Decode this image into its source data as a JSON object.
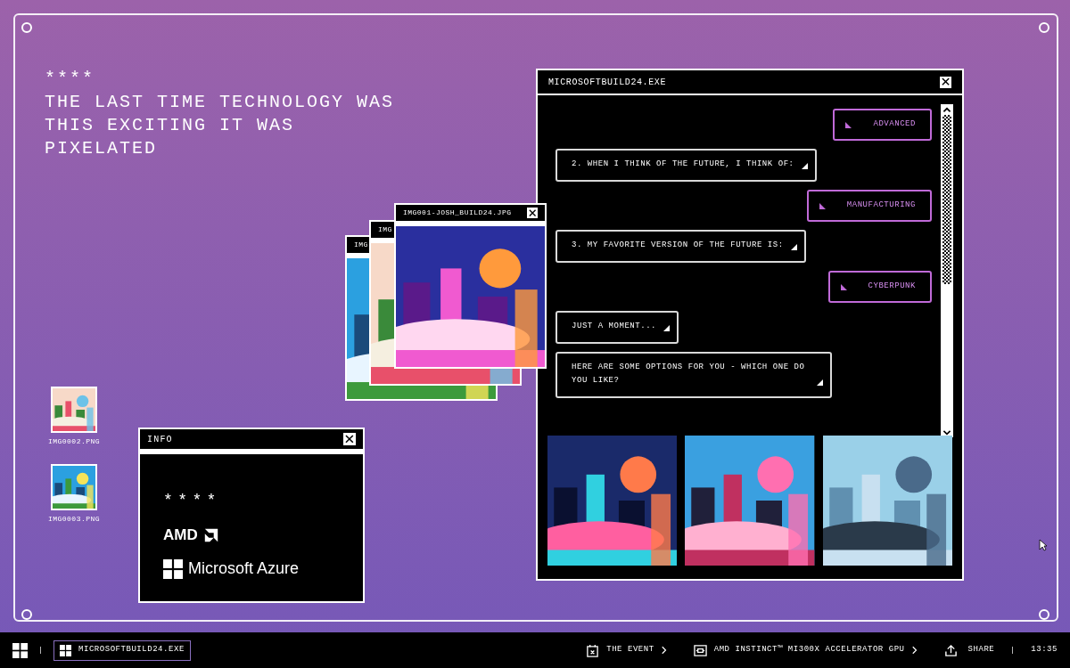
{
  "desktop": {
    "stars": "****",
    "headline": "THE LAST TIME TECHNOLOGY WAS THIS EXCITING IT WAS PIXELATED",
    "icons": [
      {
        "label": "IMG0002.PNG"
      },
      {
        "label": "IMG0003.PNG"
      }
    ],
    "image_windows": [
      {
        "title": "IMG",
        "kind": "picture"
      },
      {
        "title": "IMG",
        "kind": "picture"
      },
      {
        "title": "IMG001-JOSH_BUILD24.JPG",
        "kind": "picture"
      }
    ]
  },
  "info_window": {
    "title": "INFO",
    "stars": "****",
    "brands": [
      {
        "kind": "amd",
        "label": "AMD"
      },
      {
        "kind": "azure",
        "label": "Microsoft Azure"
      }
    ]
  },
  "main_window": {
    "title": "MICROSOFTBUILD24.EXE",
    "messages": [
      {
        "kind": "answer",
        "text": "ADVANCED"
      },
      {
        "kind": "question",
        "text": "2. WHEN I THINK OF THE FUTURE, I THINK OF:"
      },
      {
        "kind": "answer",
        "text": "MANUFACTURING"
      },
      {
        "kind": "question",
        "text": "3. MY FAVORITE VERSION OF THE FUTURE IS:"
      },
      {
        "kind": "answer",
        "text": "CYBERPUNK"
      },
      {
        "kind": "question",
        "text": "JUST A MOMENT..."
      },
      {
        "kind": "question",
        "text": "HERE ARE SOME OPTIONS FOR YOU - WHICH ONE DO YOU LIKE?"
      }
    ]
  },
  "taskbar": {
    "task": "MICROSOFTBUILD24.EXE",
    "links": [
      {
        "kind": "calendar",
        "label": "THE EVENT"
      },
      {
        "kind": "chip",
        "label": "AMD INSTINCT™ MI300X ACCELERATOR GPU"
      }
    ],
    "share": "SHARE",
    "time": "13:35"
  }
}
